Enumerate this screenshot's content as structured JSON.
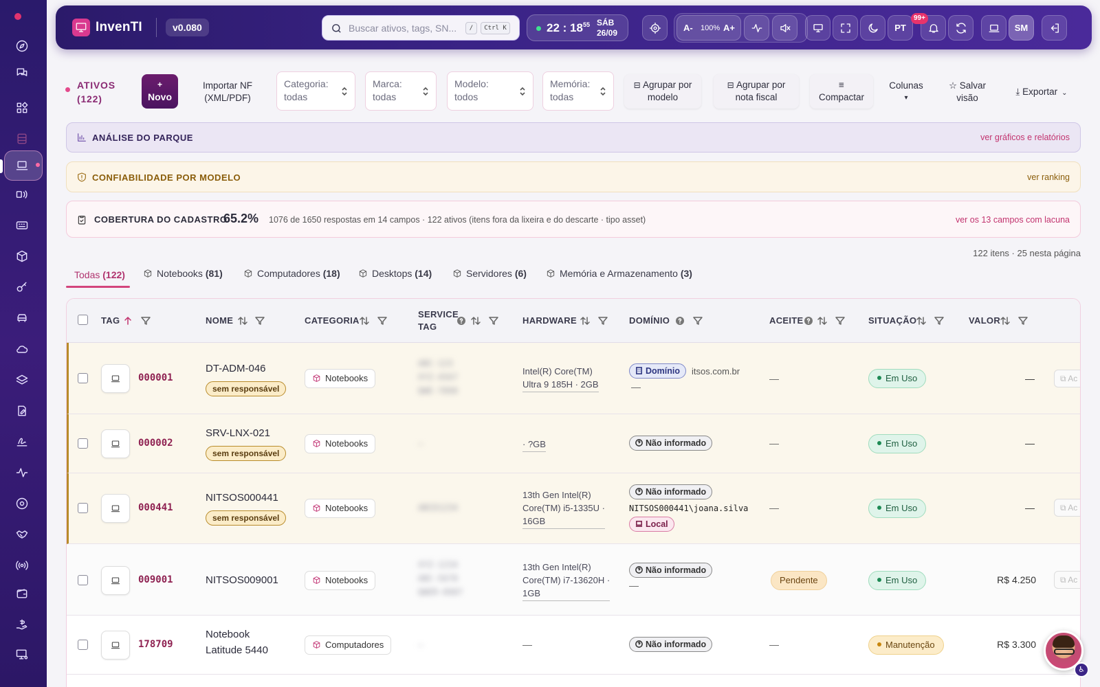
{
  "app": {
    "brand": "InvenTI",
    "version": "v0.080"
  },
  "topbar": {
    "search_placeholder": "Buscar ativos, tags, SN...",
    "kbd_slash": "/",
    "kbd_ctrlk": "Ctrl K",
    "clock": {
      "hm": "22 : 18",
      "sec": "55",
      "weekday": "SÁB",
      "date": "26/09"
    },
    "zoom": {
      "dec": "A-",
      "pct": "100%",
      "inc": "A+"
    },
    "lang": "PT",
    "notifications": "99+",
    "user_initials": "SM"
  },
  "toolbar": {
    "title": "ATIVOS",
    "count": "(122)",
    "new_plus": "+",
    "new_label": "Novo",
    "import_l1": "Importar NF",
    "import_l2": "(XML/PDF)",
    "filters": [
      {
        "label": "Categoria:",
        "value": "todas"
      },
      {
        "label": "Marca:",
        "value": "todas"
      },
      {
        "label": "Modelo:",
        "value": "todos"
      },
      {
        "label": "Memória:",
        "value": "todas"
      }
    ],
    "group_model_l1": "Agrupar por",
    "group_model_l2": "modelo",
    "group_nf_l1": "Agrupar por",
    "group_nf_l2": "nota fiscal",
    "compact_icon": "≡",
    "compact": "Compactar",
    "columns": "Colunas",
    "columns_caret": "▾",
    "save_l1": "☆ Salvar",
    "save_l2": "visão",
    "export": "Exportar"
  },
  "banners": {
    "analysis": {
      "title": "ANÁLISE DO PARQUE",
      "link": "ver gráficos e relatórios"
    },
    "reliability": {
      "title": "CONFIABILIDADE POR MODELO",
      "link": "ver ranking"
    },
    "coverage": {
      "title": "COBERTURA DO CADASTRO",
      "pct": "65.2%",
      "detail": "1076 de 1650 respostas em 14 campos · 122 ativos (itens fora da lixeira e do descarte · tipo asset)",
      "link": "ver os 13 campos com lacuna"
    }
  },
  "items_info": "122 itens · 25 nesta página",
  "tabs": [
    {
      "label": "Todas",
      "count": "(122)"
    },
    {
      "label": "Notebooks",
      "count": "(81)"
    },
    {
      "label": "Computadores",
      "count": "(18)"
    },
    {
      "label": "Desktops",
      "count": "(14)"
    },
    {
      "label": "Servidores",
      "count": "(6)"
    },
    {
      "label": "Memória e Armazenamento",
      "count": "(3)"
    }
  ],
  "columns": {
    "tag": "TAG",
    "name": "NOME",
    "category": "CATEGORIA",
    "service_l1": "SERVICE",
    "service_l2": "TAG",
    "hardware": "HARDWARE",
    "domain": "DOMÍNIO",
    "accept": "ACEITE",
    "status": "SITUAÇÃO",
    "value": "VALOR"
  },
  "rows": [
    {
      "tag": "000001",
      "name": "DT-ADM-046",
      "no_owner": "sem responsável",
      "category": "Notebooks",
      "service": "",
      "hw1": "Intel(R) Core(TM)",
      "hw2": "Ultra 9 185H · 2GB",
      "domain_pill": "Domínio",
      "domain_text": "itsos.com.br",
      "domain_dash": "—",
      "accept": "—",
      "status": "Em Uso",
      "value": "—",
      "action": "Ac"
    },
    {
      "tag": "000002",
      "name": "SRV-LNX-021",
      "no_owner": "sem responsável",
      "category": "Notebooks",
      "hw1": "· ?GB",
      "domain_pill": "Não informado",
      "accept": "—",
      "status": "Em Uso",
      "value": "—"
    },
    {
      "tag": "000441",
      "name": "NITSOS000441",
      "no_owner": "sem responsável",
      "category": "Notebooks",
      "hw1": "13th Gen Intel(R)",
      "hw2": "Core(TM) i5-1335U ·",
      "hw3": "16GB",
      "domain_pill": "Não informado",
      "domain_user": "NITSOS000441\\joana.silva",
      "domain_local": "Local",
      "accept": "—",
      "status": "Em Uso",
      "value": "—",
      "action": "Ac"
    },
    {
      "tag": "009001",
      "name": "NITSOS009001",
      "category": "Notebooks",
      "hw1": "13th Gen Intel(R)",
      "hw2": "Core(TM) i7-13620H ·",
      "hw3": "1GB",
      "domain_pill": "Não informado",
      "domain_dash": "—",
      "accept": "Pendente",
      "status": "Em Uso",
      "value": "R$ 4.250",
      "action": "Ac"
    },
    {
      "tag": "178709",
      "name_l1": "Notebook",
      "name_l2": "Latitude 5440",
      "category": "Computadores",
      "hw1": "—",
      "domain_pill": "Não informado",
      "accept": "—",
      "status": "Manutenção",
      "value": "R$ 3.300"
    }
  ]
}
